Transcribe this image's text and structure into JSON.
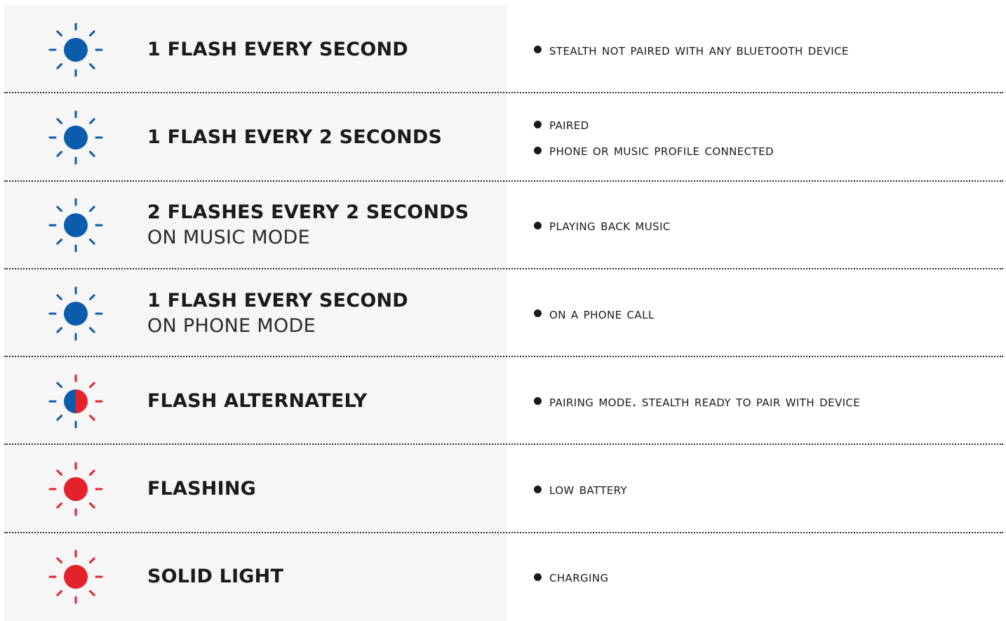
{
  "colors": {
    "blue": "#0b5cad",
    "red": "#e3222b",
    "panel": "#f6f6f6",
    "text": "#1a1a1a"
  },
  "rows": [
    {
      "led": "blue-led-icon",
      "title": "1 FLASH EVERY SECOND",
      "subtitle": "",
      "bullets": [
        "STEALTH NOT PAIRED WITH ANY BLUETOOTH DEVICE"
      ]
    },
    {
      "led": "blue-led-icon",
      "title": "1 FLASH EVERY 2 SECONDS",
      "subtitle": "",
      "bullets": [
        "PAIRED",
        "PHONE OR MUSIC PROFILE CONNECTED"
      ]
    },
    {
      "led": "blue-led-icon",
      "title": "2 FLASHES EVERY 2 SECONDS",
      "subtitle": "ON MUSIC MODE",
      "bullets": [
        "PLAYING BACK MUSIC"
      ]
    },
    {
      "led": "blue-led-icon",
      "title": "1 FLASH EVERY SECOND",
      "subtitle": "ON PHONE MODE",
      "bullets": [
        "ON A PHONE CALL"
      ]
    },
    {
      "led": "blue-red-led-icon",
      "title": "FLASH ALTERNATELY",
      "subtitle": "",
      "bullets": [
        "PAIRING MODE. STEALTH READY TO PAIR WITH DEVICE"
      ]
    },
    {
      "led": "red-led-icon",
      "title": "FLASHING",
      "subtitle": "",
      "bullets": [
        "LOW BATTERY"
      ]
    },
    {
      "led": "red-led-icon",
      "title": "SOLID LIGHT",
      "subtitle": "",
      "bullets": [
        "CHARGING"
      ]
    }
  ]
}
